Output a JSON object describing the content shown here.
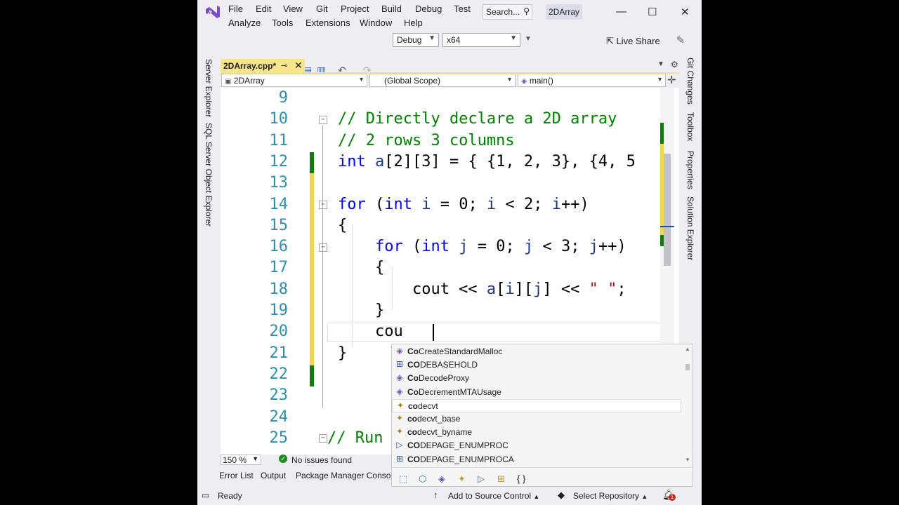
{
  "menu": {
    "row1": [
      "File",
      "Edit",
      "View",
      "Git",
      "Project",
      "Build",
      "Debug",
      "Test"
    ],
    "row2": [
      "Analyze",
      "Tools",
      "Extensions",
      "Window",
      "Help"
    ],
    "search_placeholder": "Search...",
    "solution_name": "2DArray"
  },
  "toolbar": {
    "config": "Debug",
    "platform": "x64",
    "live_share": "Live Share"
  },
  "left_tabs": [
    "Server Explorer",
    "SQL Server Object Explorer"
  ],
  "right_tabs": [
    "Git Changes",
    "Toolbox",
    "Properties",
    "Solution Explorer"
  ],
  "document": {
    "tab_label": "2DArray.cpp*"
  },
  "navbar": {
    "project": "2DArray",
    "scope": "(Global Scope)",
    "member": "main()"
  },
  "code_lines": [
    {
      "n": "9",
      "parts": []
    },
    {
      "n": "10",
      "parts": [
        [
          "cm",
          "// Directly declare a 2D array"
        ]
      ]
    },
    {
      "n": "11",
      "parts": [
        [
          "cm",
          "// 2 rows 3 columns"
        ]
      ]
    },
    {
      "n": "12",
      "parts": [
        [
          "kw",
          "int"
        ],
        [
          "",
          " "
        ],
        [
          "id",
          "a"
        ],
        [
          "",
          "[2][3] = { {1, 2, 3}, {4, 5"
        ]
      ]
    },
    {
      "n": "13",
      "parts": []
    },
    {
      "n": "14",
      "parts": [
        [
          "kw",
          "for"
        ],
        [
          "",
          " ("
        ],
        [
          "kw",
          "int"
        ],
        [
          "",
          " "
        ],
        [
          "id",
          "i"
        ],
        [
          "",
          " = 0; "
        ],
        [
          "id",
          "i"
        ],
        [
          "",
          " < 2; "
        ],
        [
          "id",
          "i"
        ],
        [
          "",
          "++)"
        ]
      ]
    },
    {
      "n": "15",
      "parts": [
        [
          "",
          "{"
        ]
      ]
    },
    {
      "n": "16",
      "parts": [
        [
          "",
          "    "
        ],
        [
          "kw",
          "for"
        ],
        [
          "",
          " ("
        ],
        [
          "kw",
          "int"
        ],
        [
          "",
          " "
        ],
        [
          "id",
          "j"
        ],
        [
          "",
          " = 0; "
        ],
        [
          "id",
          "j"
        ],
        [
          "",
          " < 3; "
        ],
        [
          "id",
          "j"
        ],
        [
          "",
          "++)"
        ]
      ]
    },
    {
      "n": "17",
      "parts": [
        [
          "",
          "    {"
        ]
      ]
    },
    {
      "n": "18",
      "parts": [
        [
          "",
          "        cout << "
        ],
        [
          "id",
          "a"
        ],
        [
          "",
          "["
        ],
        [
          "id",
          "i"
        ],
        [
          "",
          "]["
        ],
        [
          "id",
          "j"
        ],
        [
          "",
          "] << "
        ],
        [
          "st",
          "\" \""
        ],
        [
          "",
          ";"
        ]
      ]
    },
    {
      "n": "19",
      "parts": [
        [
          "",
          "    }"
        ]
      ]
    },
    {
      "n": "20",
      "parts": [
        [
          "",
          "    cou"
        ]
      ]
    },
    {
      "n": "21",
      "parts": [
        [
          "",
          "}"
        ]
      ]
    },
    {
      "n": "22",
      "parts": []
    },
    {
      "n": "23",
      "parts": []
    },
    {
      "n": "24",
      "parts": []
    },
    {
      "n": "25",
      "parts": [
        [
          "cm",
          "// Run p"
        ]
      ]
    }
  ],
  "completion": [
    {
      "label": "CoCreateStandardMalloc",
      "icon": "method-icon",
      "glyph": "◈"
    },
    {
      "label": "CODEBASEHOLD",
      "icon": "struct-icon",
      "glyph": "⊞"
    },
    {
      "label": "CoDecodeProxy",
      "icon": "method-icon",
      "glyph": "◈"
    },
    {
      "label": "CoDecrementMTAUsage",
      "icon": "method-icon",
      "glyph": "◈"
    },
    {
      "label": "codecvt",
      "icon": "class-template-icon",
      "glyph": "✦"
    },
    {
      "label": "codecvt_base",
      "icon": "class-template-icon",
      "glyph": "✦"
    },
    {
      "label": "codecvt_byname",
      "icon": "class-template-icon",
      "glyph": "✦"
    },
    {
      "label": "CODEPAGE_ENUMPROC",
      "icon": "typedef-icon",
      "glyph": "▷"
    },
    {
      "label": "CODEPAGE_ENUMPROCA",
      "icon": "struct-icon",
      "glyph": "⊞"
    }
  ],
  "completion_selected_index": 4,
  "editor_status": {
    "zoom": "150 %",
    "issues": "No issues found"
  },
  "bottom_tabs": [
    "Error List",
    "Output",
    "Package Manager Consol"
  ],
  "statusbar": {
    "ready": "Ready",
    "add_to_source": "Add to Source Control",
    "select_repo": "Select Repository",
    "notifications_count": "1"
  },
  "colors": {
    "keyword": "#0000ff",
    "comment": "#008000",
    "line_number": "#2b91af",
    "string": "#a31515",
    "tab_active": "#f6e58a",
    "change_saved": "#107c10",
    "change_unsaved": "#f0d64b"
  }
}
